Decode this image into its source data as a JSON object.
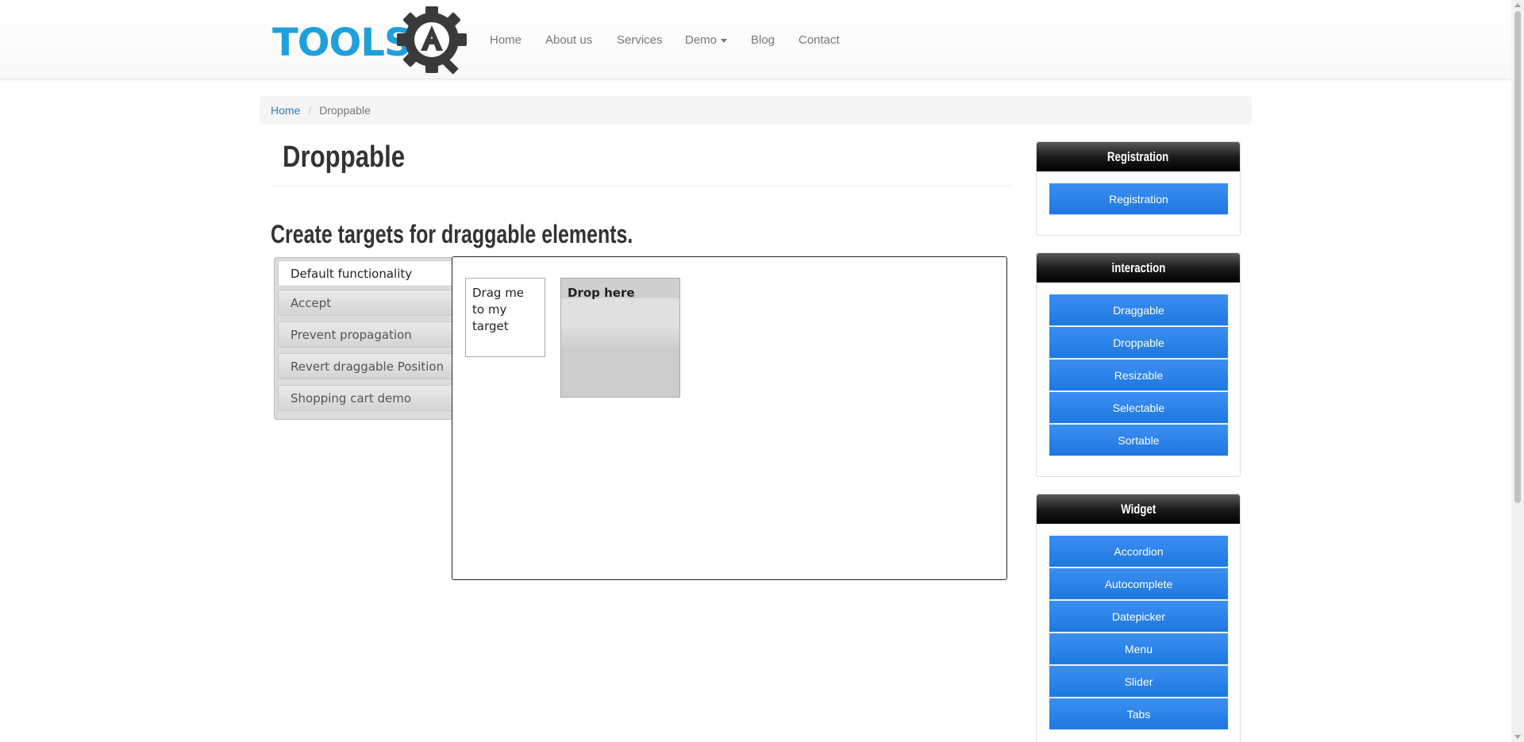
{
  "brand": {
    "name": "TOOLS",
    "logo_letter": "A"
  },
  "nav": {
    "items": [
      {
        "label": "Home"
      },
      {
        "label": "About us"
      },
      {
        "label": "Services"
      },
      {
        "label": "Demo"
      },
      {
        "label": "Blog"
      },
      {
        "label": "Contact"
      }
    ]
  },
  "breadcrumb": {
    "home": "Home",
    "separator": "/",
    "current": "Droppable"
  },
  "page": {
    "title": "Droppable",
    "subtitle": "Create targets for draggable elements."
  },
  "tabs": [
    {
      "label": "Default functionality",
      "active": true
    },
    {
      "label": "Accept",
      "active": false
    },
    {
      "label": "Prevent propagation",
      "active": false
    },
    {
      "label": "Revert draggable Position",
      "active": false
    },
    {
      "label": "Shopping cart demo",
      "active": false
    }
  ],
  "demo": {
    "draggable_text": "Drag me to my target",
    "droppable_text": "Drop here"
  },
  "sidebar": {
    "registration": {
      "title": "Registration",
      "buttons": [
        "Registration"
      ]
    },
    "interaction": {
      "title": "interaction",
      "buttons": [
        "Draggable",
        "Droppable",
        "Resizable",
        "Selectable",
        "Sortable"
      ]
    },
    "widget": {
      "title": "Widget",
      "buttons": [
        "Accordion",
        "Autocomplete",
        "Datepicker",
        "Menu",
        "Slider",
        "Tabs"
      ]
    }
  },
  "colors": {
    "brand_blue": "#1ea0dd",
    "button_blue": "#2583e8",
    "link_blue": "#337ab7",
    "widget_header": "#1c1c1c"
  },
  "icons": [
    "gear-icon",
    "magnifier-icon",
    "caret-down-icon"
  ]
}
